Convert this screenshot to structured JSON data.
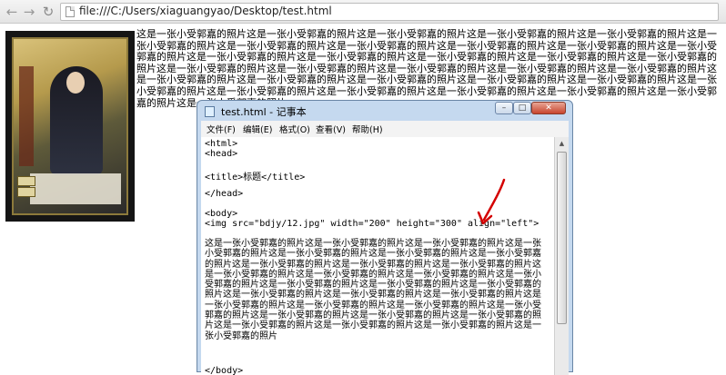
{
  "browser": {
    "back_icon": "back-arrow-icon",
    "forward_icon": "forward-arrow-icon",
    "reload_icon": "reload-icon",
    "url": "file:///C:/Users/xiaguangyao/Desktop/test.html"
  },
  "page": {
    "paragraph": "这是一张小受郭嘉的照片这是一张小受郭嘉的照片这是一张小受郭嘉的照片这是一张小受郭嘉的照片这是一张小受郭嘉的照片这是一张小受郭嘉的照片这是一张小受郭嘉的照片这是一张小受郭嘉的照片这是一张小受郭嘉的照片这是一张小受郭嘉的照片这是一张小受郭嘉的照片这是一张小受郭嘉的照片这是一张小受郭嘉的照片这是一张小受郭嘉的照片这是一张小受郭嘉的照片这是一张小受郭嘉的照片这是一张小受郭嘉的照片这是一张小受郭嘉的照片这是一张小受郭嘉的照片这是一张小受郭嘉的照片这是一张小受郭嘉的照片这是一张小受郭嘉的照片这是一张小受郭嘉的照片这是一张小受郭嘉的照片这是一张小受郭嘉的照片这是一张小受郭嘉的照片这是一张小受郭嘉的照片这是一张小受郭嘉的照片这是一张小受郭嘉的照片这是一张小受郭嘉的照片这是一张小受郭嘉的照片这是一张小受郭嘉的照片这是一张小受郭嘉的照片"
  },
  "notepad": {
    "title": "test.html - 记事本",
    "controls": {
      "minimize": "–",
      "maximize": "□",
      "close": "✕"
    },
    "menu": [
      "文件(F)",
      "编辑(E)",
      "格式(O)",
      "查看(V)",
      "帮助(H)"
    ],
    "code_lines": [
      "<html>",
      "<head>",
      "",
      "<title>标题</title>",
      "",
      "</head>",
      "",
      "<body>",
      "<img src=\"bdjy/12.jpg\" width=\"200\" height=\"300\" align=\"left\">"
    ],
    "body_text": "这是一张小受郭嘉的照片这是一张小受郭嘉的照片这是一张小受郭嘉的照片这是一张小受郭嘉的照片这是一张小受郭嘉的照片这是一张小受郭嘉的照片这是一张小受郭嘉的照片这是一张小受郭嘉的照片这是一张小受郭嘉的照片这是一张小受郭嘉的照片这是一张小受郭嘉的照片这是一张小受郭嘉的照片这是一张小受郭嘉的照片这是一张小受郭嘉的照片这是一张小受郭嘉的照片这是一张小受郭嘉的照片这是一张小受郭嘉的照片这是一张小受郭嘉的照片这是一张小受郭嘉的照片这是一张小受郭嘉的照片这是一张小受郭嘉的照片这是一张小受郭嘉的照片这是一张小受郭嘉的照片这是一张小受郭嘉的照片这是一张小受郭嘉的照片这是一张小受郭嘉的照片这是一张小受郭嘉的照片这是一张小受郭嘉的照片这是一张小受郭嘉的照片这是一张小受郭嘉的照片这是一张小受郭嘉的照片",
    "closing_line": "</body>"
  },
  "annotation": {
    "arrow_color": "#d40000"
  }
}
